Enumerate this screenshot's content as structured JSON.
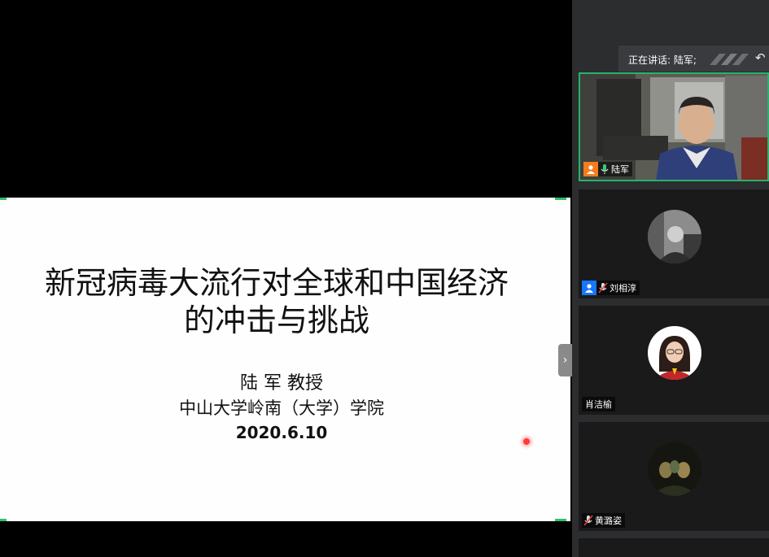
{
  "slide": {
    "title_line1": "新冠病毒大流行对全球和中国经济",
    "title_line2": "的冲击与挑战",
    "author": "陆 军 教授",
    "affiliation": "中山大学岭南（大学）学院",
    "date": "2020.6.10"
  },
  "speaking": {
    "text": "正在讲话: 陆军;"
  },
  "participants": [
    {
      "name": "陆军",
      "mic": "on",
      "badge": "orange"
    },
    {
      "name": "刘相淳",
      "mic": "muted",
      "badge": "blue"
    },
    {
      "name": "肖洁榆",
      "mic": "none",
      "badge": "none"
    },
    {
      "name": "黄潞姿",
      "mic": "muted",
      "badge": "none"
    }
  ],
  "colors": {
    "accent_green": "#26b36b",
    "panel_bg": "#2b2d2f",
    "badge_orange": "#f57c1f",
    "badge_blue": "#1677ff"
  }
}
